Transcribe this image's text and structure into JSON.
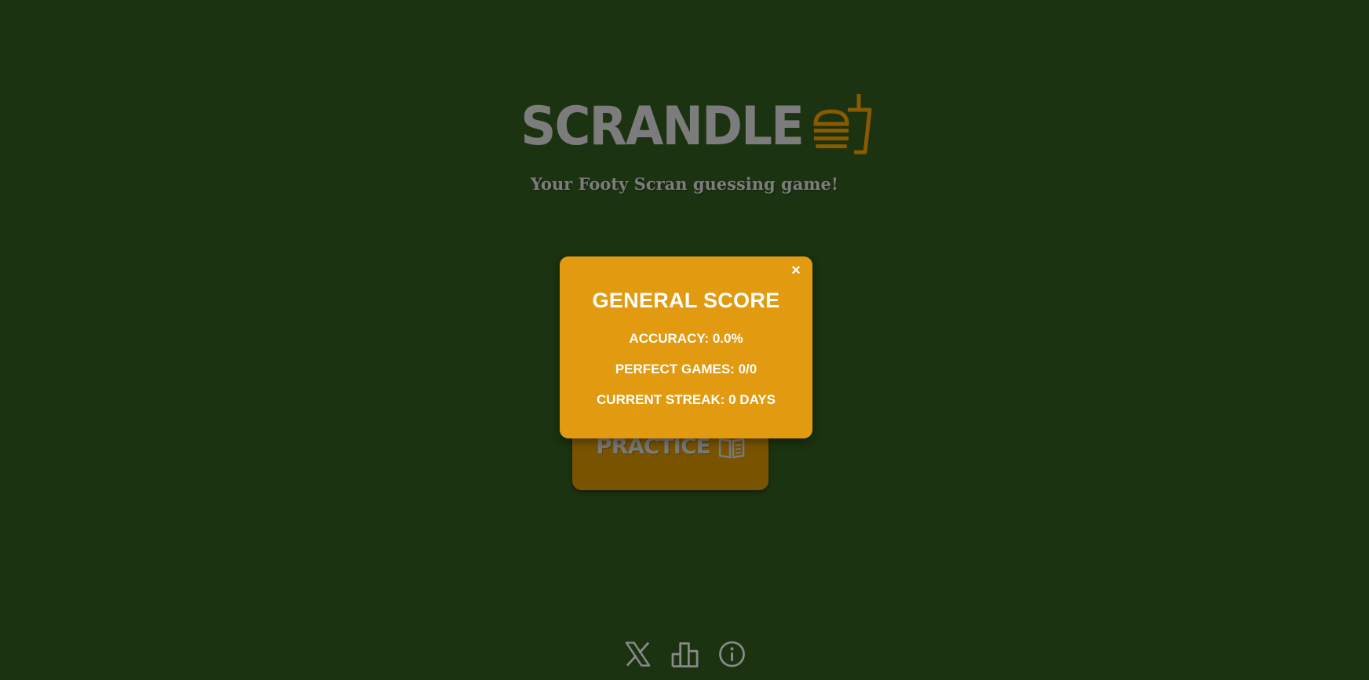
{
  "header": {
    "logo_text": "SCRANDLE",
    "tagline": "Your Footy Scran guessing game!"
  },
  "main": {
    "practice_label": "PRACTICE"
  },
  "modal": {
    "close_label": "×",
    "title": "GENERAL SCORE",
    "accuracy": "ACCURACY: 0.0%",
    "perfect_games": "PERFECT GAMES: 0/0",
    "current_streak": "CURRENT STREAK: 0 DAYS"
  },
  "footer": {
    "icons": [
      "x-logo-icon",
      "leaderboard-icon",
      "info-icon"
    ]
  },
  "colors": {
    "background": "#1b3310",
    "modal": "#e29a10",
    "practice_button": "#795400",
    "logo_accent": "#8a5a00",
    "muted_text": "#7c7c7c"
  }
}
